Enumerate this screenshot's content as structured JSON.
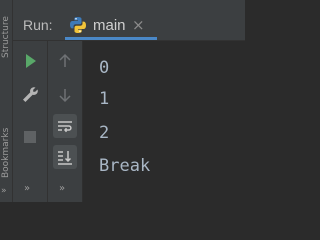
{
  "sidebar": {
    "top_label": "Structure",
    "bottom_label": "Bookmarks",
    "more_glyph": "»"
  },
  "run_panel": {
    "run_label": "Run:",
    "tab_label": "main",
    "tab_icon": "python-icon",
    "close_glyph": "×"
  },
  "toolbar_left": {
    "buttons": [
      "rerun-icon",
      "wrench-icon",
      "stop-icon"
    ],
    "more_glyph": "»"
  },
  "toolbar_right": {
    "buttons": [
      "scroll-up-icon",
      "scroll-down-icon",
      "soft-wrap-icon",
      "scroll-to-end-icon"
    ],
    "more_glyph": "»"
  },
  "console": {
    "lines": [
      "0",
      "1",
      "2",
      "Break"
    ]
  },
  "colors": {
    "panel_bg": "#3c3f41",
    "console_bg": "#2b2b2b",
    "console_text": "#a9b7c6",
    "run_green": "#59a869",
    "tab_underline": "#4a88c7"
  }
}
